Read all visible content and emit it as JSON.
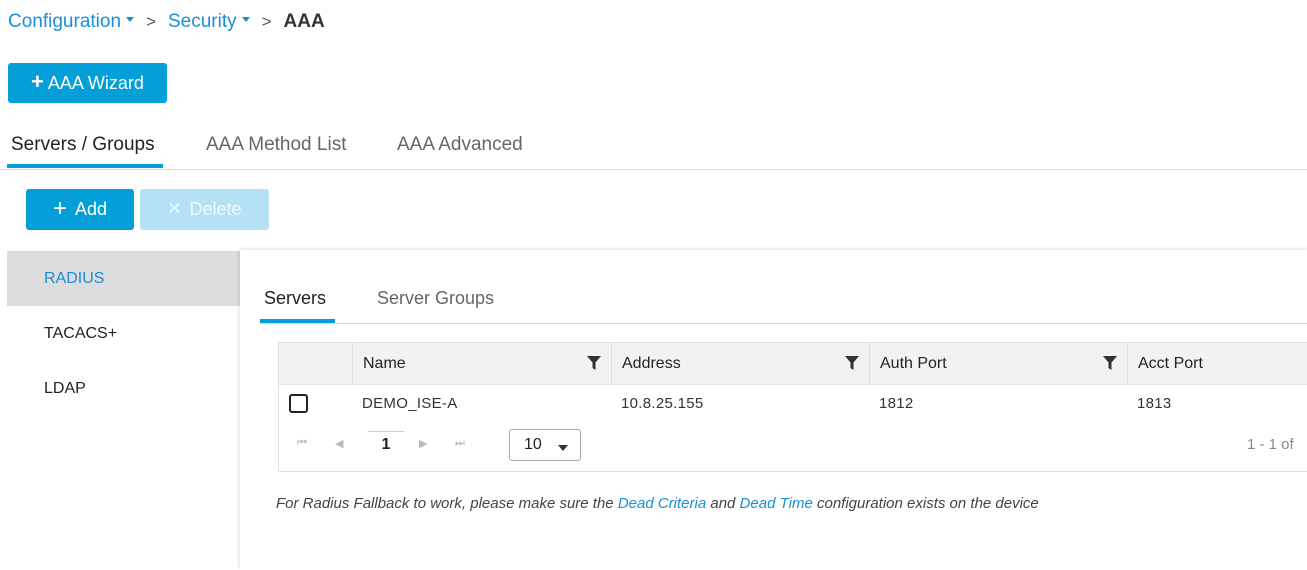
{
  "breadcrumb": {
    "item1": "Configuration",
    "item2": "Security",
    "current": "AAA",
    "separator": ">"
  },
  "wizard": {
    "plus": "+",
    "label": "AAA Wizard"
  },
  "top_tabs": [
    "Servers / Groups",
    "AAA Method List",
    "AAA Advanced"
  ],
  "actions": {
    "add_icon": "+",
    "add": "Add",
    "delete_icon": "×",
    "delete": "Delete"
  },
  "sidebar": [
    "RADIUS",
    "TACACS+",
    "LDAP"
  ],
  "sub_tabs": [
    "Servers",
    "Server Groups"
  ],
  "table": {
    "columns": [
      "Name",
      "Address",
      "Auth Port",
      "Acct Port"
    ],
    "rows": [
      {
        "name": "DEMO_ISE-A",
        "address": "10.8.25.155",
        "auth_port": "1812",
        "acct_port": "1813"
      }
    ]
  },
  "pager": {
    "page": "1",
    "page_size": "10",
    "range": "1 - 1 of"
  },
  "note": {
    "part1": "For Radius Fallback to work, please make sure the ",
    "link1": "Dead Criteria",
    "part2": " and ",
    "link2": "Dead Time",
    "part3": " configuration exists on the device"
  },
  "colors": {
    "accent": "#049fd9",
    "link": "#1a8ed6",
    "active_bg": "#dcdcdc"
  },
  "icons": {
    "filter": "filter-icon",
    "first": "first-page-icon",
    "prev": "prev-page-icon",
    "next": "next-page-icon",
    "last": "last-page-icon"
  }
}
